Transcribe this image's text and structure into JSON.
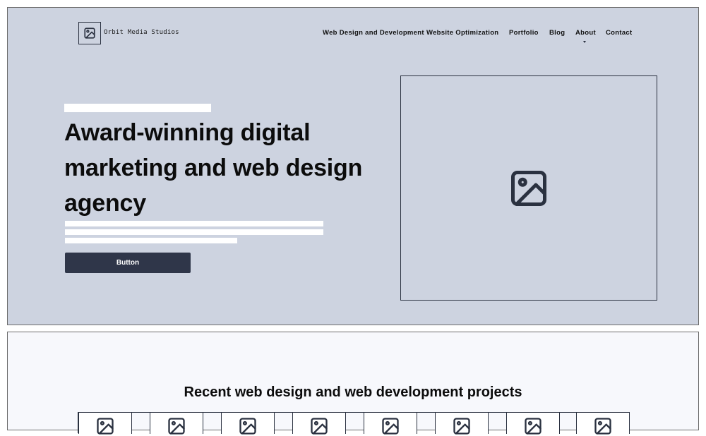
{
  "header": {
    "logo_icon": "image-placeholder-icon",
    "logo_text": "Orbit Media Studios",
    "nav": [
      {
        "label": "Web Design and Development"
      },
      {
        "label": "Website Optimization"
      },
      {
        "label": "Portfolio"
      },
      {
        "label": "Blog"
      },
      {
        "label": "About",
        "has_dropdown": true
      },
      {
        "label": "Contact"
      }
    ]
  },
  "hero": {
    "headline_lines": [
      "Award-winning digital",
      "marketing and web design",
      "agency"
    ],
    "button_label": "Button",
    "image_icon": "image-placeholder-icon"
  },
  "projects": {
    "heading": "Recent web design and web development projects",
    "thumbnail_icon": "image-placeholder-icon",
    "thumbnail_count": 8
  },
  "colors": {
    "hero_background": "#cdd3e0",
    "section_background": "#f7f8fc",
    "button_background": "#2f3649",
    "placeholder_bar": "#ffffff",
    "icon_stroke": "#2a3140"
  }
}
